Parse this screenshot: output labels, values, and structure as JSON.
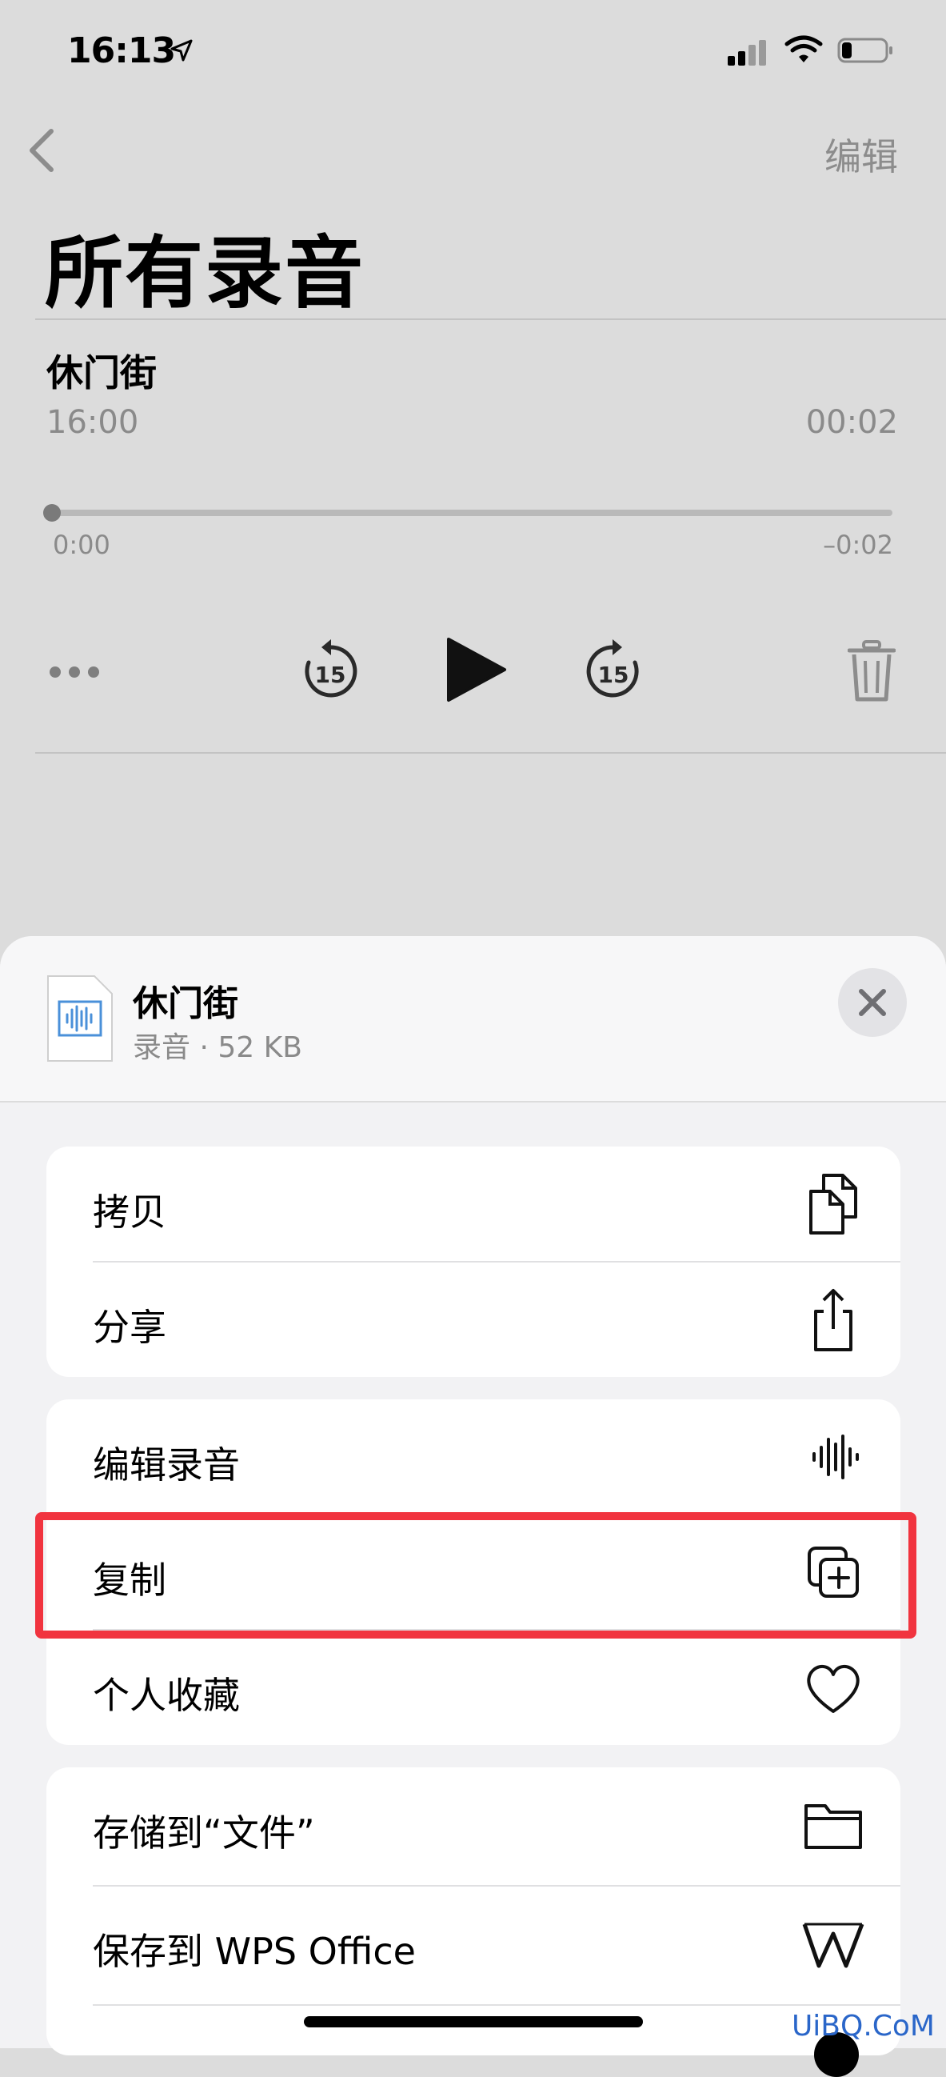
{
  "status_bar": {
    "time": "16:13"
  },
  "nav": {
    "edit_label": "编辑",
    "title": "所有录音"
  },
  "recording": {
    "name": "休门街",
    "date": "16:00",
    "duration": "00:02",
    "elapsed": "0:00",
    "remaining": "–0:02",
    "progress": 0,
    "skip_seconds": "15"
  },
  "sheet": {
    "file_name": "休门街",
    "file_meta": "录音 · 52 KB",
    "groups": [
      {
        "items": [
          {
            "label": "拷贝",
            "icon": "copy-icon"
          },
          {
            "label": "分享",
            "icon": "share-icon"
          }
        ]
      },
      {
        "items": [
          {
            "label": "编辑录音",
            "icon": "waveform-icon"
          },
          {
            "label": "复制",
            "icon": "duplicate-icon"
          },
          {
            "label": "个人收藏",
            "icon": "heart-icon"
          }
        ]
      },
      {
        "items": [
          {
            "label": "存储到“文件”",
            "icon": "folder-icon"
          },
          {
            "label": "保存到 WPS Office",
            "icon": "wps-icon"
          }
        ]
      }
    ]
  },
  "watermark": "UiBQ.CoM",
  "colors": {
    "highlight": "#f1343f",
    "accent_icon": "#4a90d9"
  }
}
